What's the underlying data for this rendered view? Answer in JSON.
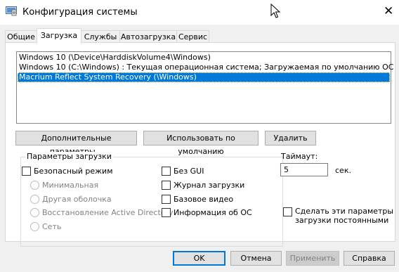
{
  "window": {
    "title": "Конфигурация системы",
    "close_glyph": "✕"
  },
  "tabs": [
    {
      "label": "Общие"
    },
    {
      "label": "Загрузка"
    },
    {
      "label": "Службы"
    },
    {
      "label": "Автозагрузка"
    },
    {
      "label": "Сервис"
    }
  ],
  "active_tab": "Загрузка",
  "os_list": [
    "Windows 10 (\\Device\\HarddiskVolume4\\Windows)",
    "Windows 10 (C:\\Windows) : Текущая операционная система; Загружаемая по умолчанию ОС",
    "Macrium Reflect System Recovery (\\Windows)"
  ],
  "os_selected": "Macrium Reflect System Recovery (\\Windows)",
  "list_buttons": {
    "advanced": "Дополнительные параметры...",
    "set_default": "Использовать по умолчанию",
    "delete": "Удалить"
  },
  "boot_options": {
    "group_title": "Параметры загрузки",
    "safe_boot": {
      "label": "Безопасный режим",
      "checked": false
    },
    "safe_modes": [
      {
        "label": "Минимальная"
      },
      {
        "label": "Другая оболочка"
      },
      {
        "label": "Восстановление Active Directory"
      },
      {
        "label": "Сеть"
      }
    ],
    "no_gui": {
      "label": "Без GUI",
      "checked": false
    },
    "boot_log": {
      "label": "Журнал загрузки",
      "checked": false
    },
    "base_video": {
      "label": "Базовое видео",
      "checked": false
    },
    "os_info": {
      "label": "Информация  об ОС",
      "checked": false
    }
  },
  "timeout": {
    "label": "Таймаут:",
    "value": "5",
    "unit": "сек."
  },
  "make_permanent": {
    "label_line1": "Сделать эти параметры",
    "label_line2": "загрузки постоянными",
    "checked": false
  },
  "dialog_buttons": {
    "ok": "OK",
    "cancel": "Отмена",
    "apply": "Применить",
    "help": "Справка"
  },
  "colors": {
    "selection": "#0078d7",
    "accent_border": "#0078d7"
  },
  "icons": {
    "app": "msconfig-app-icon",
    "cursor": "mouse-pointer-icon"
  }
}
